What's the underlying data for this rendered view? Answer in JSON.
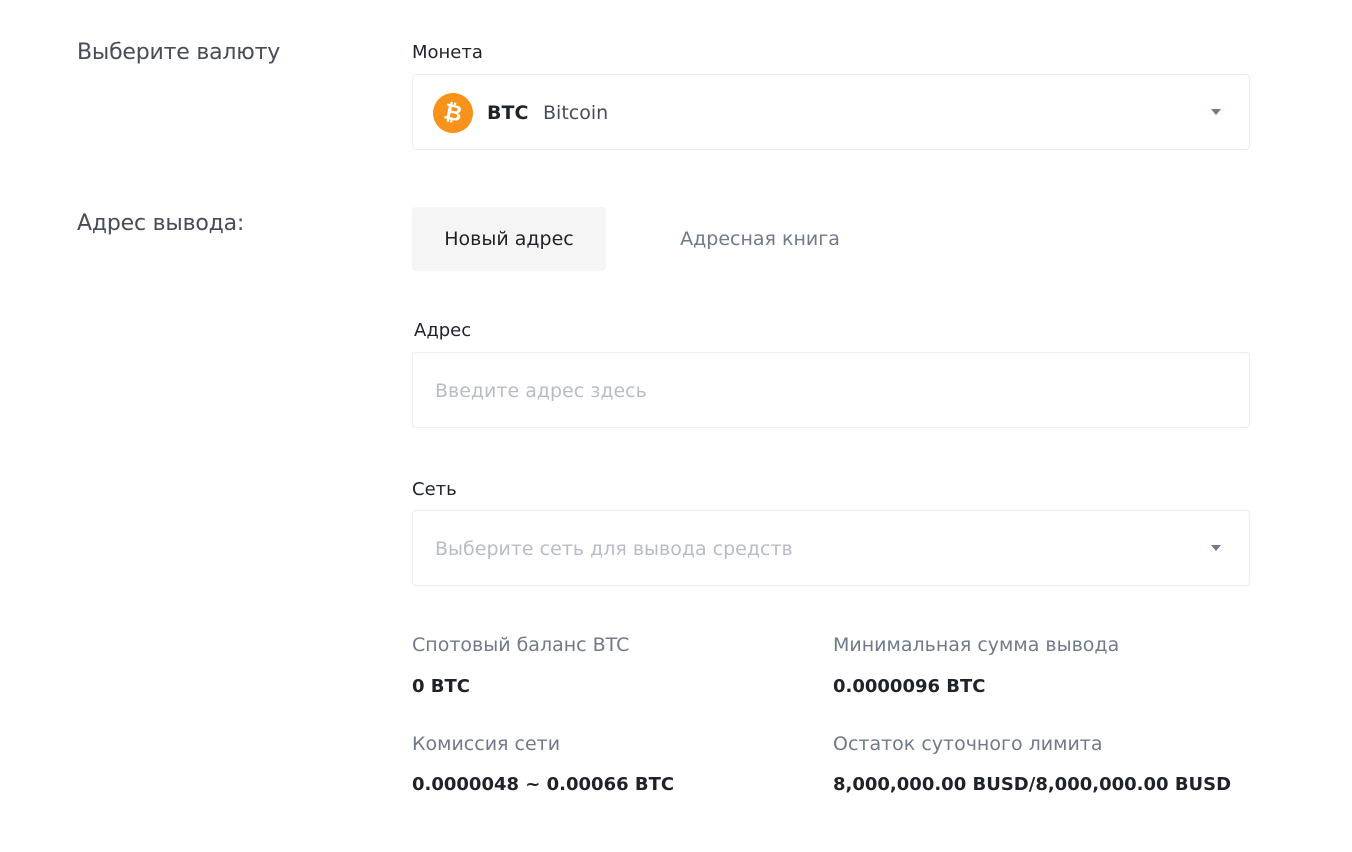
{
  "currency_section": {
    "label": "Выберите валюту",
    "coin_label": "Монета",
    "selected_coin": {
      "symbol": "BTC",
      "name": "Bitcoin",
      "icon": "bitcoin-icon",
      "icon_glyph": "₿",
      "icon_color": "#f7931a"
    }
  },
  "address_section": {
    "label": "Адрес вывода:",
    "tabs": [
      {
        "label": "Новый адрес",
        "active": true
      },
      {
        "label": "Адресная книга",
        "active": false
      }
    ],
    "address_label": "Адрес",
    "address_placeholder": "Введите адрес здесь",
    "network_label": "Сеть",
    "network_placeholder": "Выберите сеть для вывода средств"
  },
  "info": {
    "spot_balance_label": "Спотовый баланс BTC",
    "spot_balance_value": "0 BTC",
    "min_withdraw_label": "Минимальная сумма вывода",
    "min_withdraw_value": "0.0000096 BTC",
    "network_fee_label": "Комиссия сети",
    "network_fee_value": "0.0000048 ~ 0.00066 BTC",
    "daily_limit_label": "Остаток суточного лимита",
    "daily_limit_value": "8,000,000.00 BUSD/8,000,000.00 BUSD"
  }
}
